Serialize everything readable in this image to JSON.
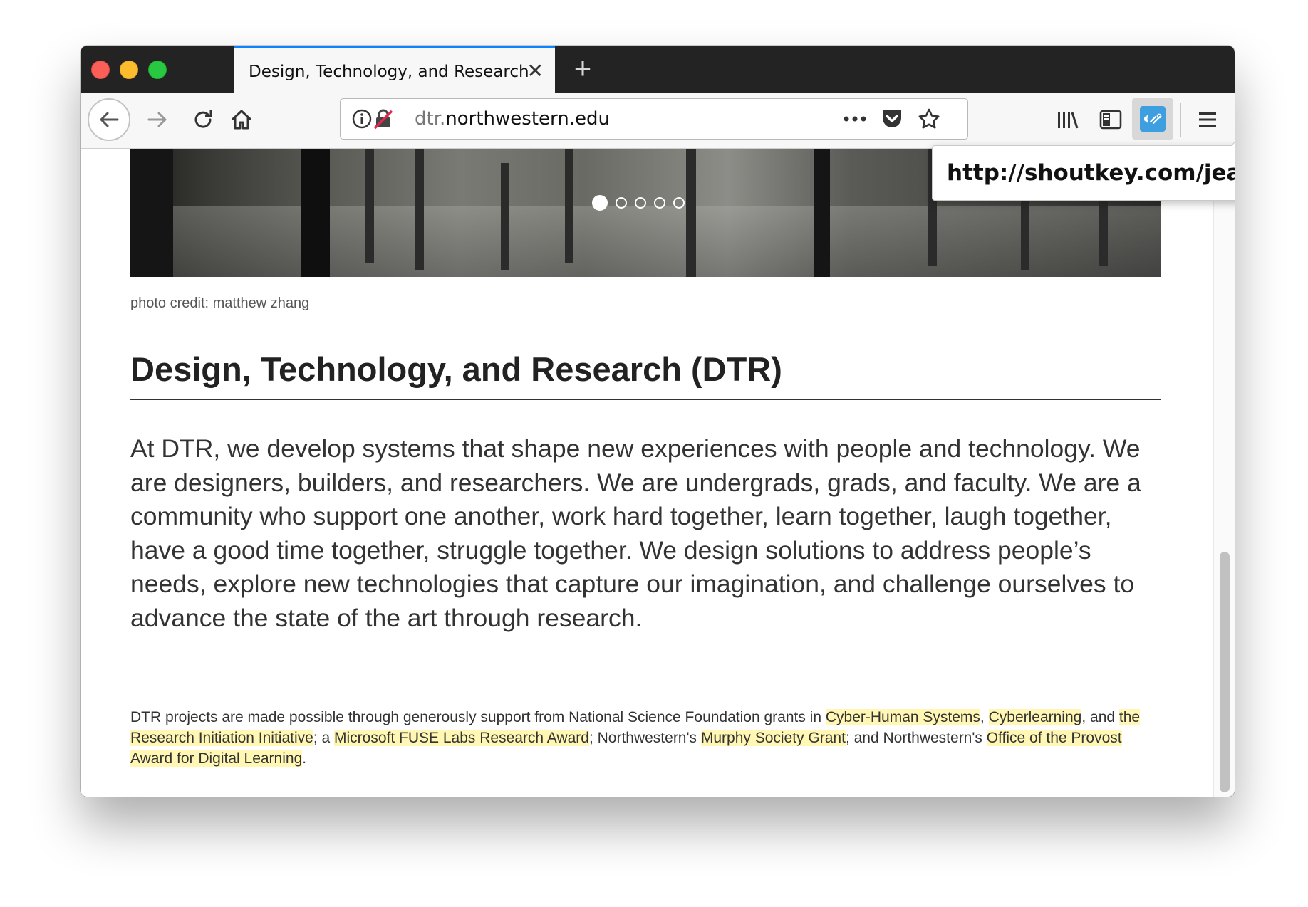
{
  "browser": {
    "tab_title": "Design, Technology, and Research",
    "url_prefix": "dtr.",
    "url_domain": "northwestern.edu",
    "tooltip_url": "http://shoutkey.com/jeans"
  },
  "carousel": {
    "slides": 5,
    "active_slide": 1
  },
  "page": {
    "photo_credit": "photo credit: matthew zhang",
    "heading": "Design, Technology, and Research (DTR)",
    "lead": "At DTR, we develop systems that shape new experiences with people and technology. We are designers, builders, and researchers. We are undergrads, grads, and faculty. We are a community who support one another, work hard together, learn together, laugh together, have a good time together, struggle together. We design solutions to address people’s needs, explore new technologies that capture our imagination, and challenge ourselves to advance the state of the art through research.",
    "funding": {
      "t1": "DTR projects are made possible through generously support from National Science Foundation grants in ",
      "l1": "Cyber-Human Systems",
      "t2": ", ",
      "l2": "Cyberlearning",
      "t3": ", and ",
      "l3": "the Research Initiation Initiative",
      "t4": "; a ",
      "l4": "Microsoft FUSE Labs Research Award",
      "t5": "; Northwestern's ",
      "l5": "Murphy Society Grant",
      "t6": "; and Northwestern's ",
      "l6": "Office of the Provost Award for Digital Learning",
      "t7": "."
    }
  },
  "icons": [
    "back-icon",
    "forward-icon",
    "reload-icon",
    "home-icon",
    "info-icon",
    "insecure-lock-icon",
    "page-actions-icon",
    "pocket-icon",
    "bookmark-star-icon",
    "library-icon",
    "sidebar-icon",
    "shoutkey-extension-icon",
    "hamburger-menu-icon",
    "close-tab-icon",
    "new-tab-icon"
  ],
  "colors": {
    "highlight": "#fff7b3",
    "tab_accent": "#0a84ff",
    "extension": "#3d9ee0"
  }
}
